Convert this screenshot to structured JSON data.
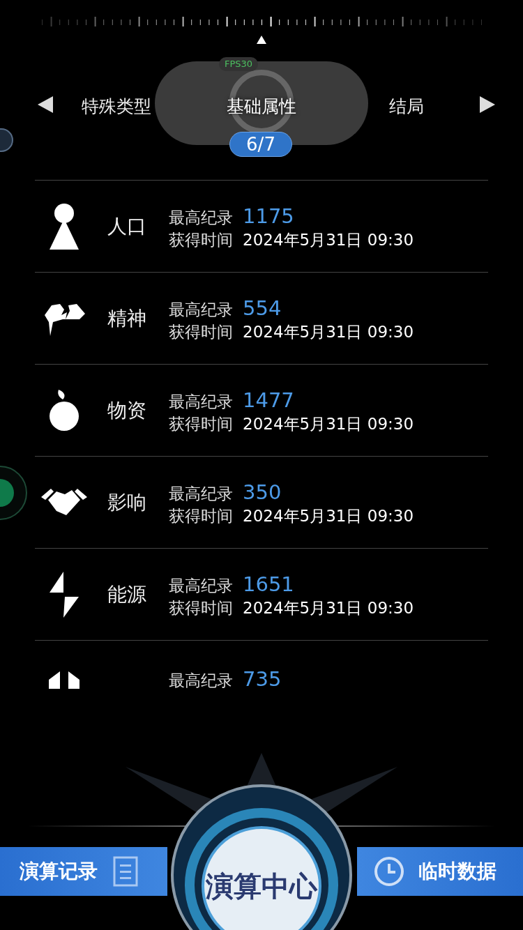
{
  "fps_label": "FPS30",
  "tabs": [
    {
      "label": "特殊类型",
      "selected": false
    },
    {
      "label": "基础属性",
      "selected": true
    },
    {
      "label": "结局",
      "selected": false
    }
  ],
  "page_indicator": "6/7",
  "records": [
    {
      "name": "人口",
      "record_label": "最高纪录",
      "record_value": "1175",
      "time_label": "获得时间",
      "time_value": "2024年5月31日 09:30"
    },
    {
      "name": "精神",
      "record_label": "最高纪录",
      "record_value": "554",
      "time_label": "获得时间",
      "time_value": "2024年5月31日 09:30"
    },
    {
      "name": "物资",
      "record_label": "最高纪录",
      "record_value": "1477",
      "time_label": "获得时间",
      "time_value": "2024年5月31日 09:30"
    },
    {
      "name": "影响",
      "record_label": "最高纪录",
      "record_value": "350",
      "time_label": "获得时间",
      "time_value": "2024年5月31日 09:30"
    },
    {
      "name": "能源",
      "record_label": "最高纪录",
      "record_value": "1651",
      "time_label": "获得时间",
      "time_value": "2024年5月31日 09:30"
    },
    {
      "record_label": "最高纪录",
      "record_value": "735"
    }
  ],
  "bottom_nav": {
    "left": "演算记录",
    "center": "演算中心",
    "right": "临时数据"
  }
}
